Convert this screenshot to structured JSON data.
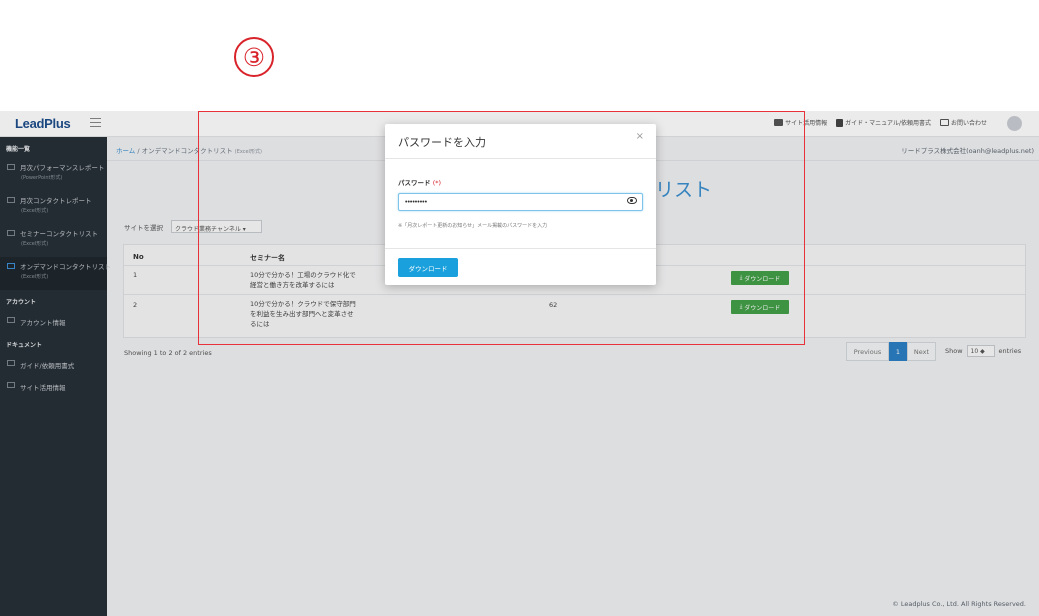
{
  "step_marker": "③",
  "header": {
    "logo": "LeadPlus",
    "nav": [
      {
        "label": "サイト活用情報",
        "icon": "briefcase-icon"
      },
      {
        "label": "ガイド・マニュアル/依頼用書式",
        "icon": "book-icon"
      },
      {
        "label": "お問い合わせ",
        "icon": "mail-icon"
      }
    ]
  },
  "sidebar": {
    "section_features": "機能一覧",
    "items": [
      {
        "label": "月次パフォーマンスレポート",
        "sub": "(PowerPoint形式)"
      },
      {
        "label": "月次コンタクトレポート",
        "sub": "(Excel形式)"
      },
      {
        "label": "セミナーコンタクトリスト",
        "sub": "(Excel形式)"
      },
      {
        "label": "オンデマンドコンタクトリスト",
        "sub": "(Excel形式)"
      }
    ],
    "section_account": "アカウント",
    "account_item": "アカウント情報",
    "section_docs": "ドキュメント",
    "doc_items": [
      "ガイド/依頼用書式",
      "サイト活用情報"
    ]
  },
  "breadcrumb": {
    "home": "ホーム",
    "separator": "/",
    "current": "オンデマンドコンタクトリスト",
    "note": "(Excel形式)"
  },
  "company": "リードプラス株式会社(oanh@leadplus.net)",
  "page_title_fragment": "リスト",
  "filter": {
    "label": "サイトを選択",
    "selected": "クラウド業務チャンネル ▾"
  },
  "table": {
    "headers": {
      "no": "No",
      "seminar": "セミナー名"
    },
    "rows": [
      {
        "no": "1",
        "seminar": [
          "10分で分かる！工場のクラウド化で",
          "経営と働き方を改革するには"
        ],
        "count": "",
        "button": "ダウンロード"
      },
      {
        "no": "2",
        "seminar": [
          "10分で分かる！クラウドで保守部門",
          "を利益を生み出す部門へと変革させ",
          "るには"
        ],
        "count": "62",
        "button": "ダウンロード"
      }
    ]
  },
  "pagination": {
    "info": "Showing 1 to 2 of 2 entries",
    "prev": "Previous",
    "current": "1",
    "next": "Next",
    "show_label": "Show",
    "show_value": "10",
    "entries_label": "entries"
  },
  "footer": "© Leadplus Co., Ltd. All Rights Reserved.",
  "modal": {
    "title": "パスワードを入力",
    "close": "×",
    "field_label": "パスワード",
    "required_mark": "(*)",
    "password_value": "•••••••••",
    "hint": "※「月次レポート更新のお知らせ」メール掲載のパスワードを入力",
    "download": "ダウンロード"
  },
  "colors": {
    "highlight": "#e8323a",
    "primary": "#1aa0dc",
    "download_green": "#43a047",
    "sidebar_bg": "#263038"
  }
}
